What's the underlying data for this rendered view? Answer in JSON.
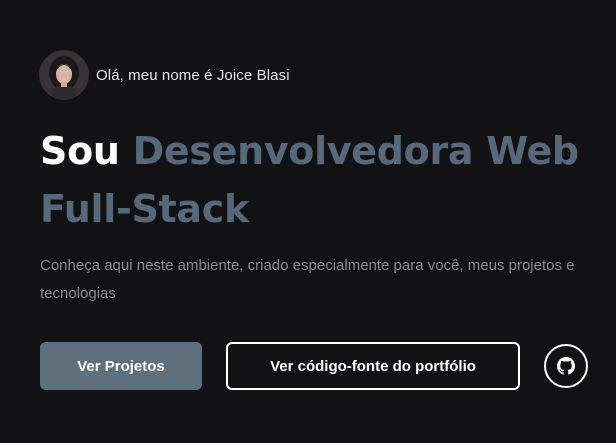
{
  "intro": {
    "greeting": "Olá, meu nome é Joice Blasi",
    "avatar_icon": "profile-photo"
  },
  "headline": {
    "prefix": "Sou",
    "accent_line1": "Desenvolvedora Web",
    "accent_line2": "Full-Stack"
  },
  "description": "Conheça aqui neste ambiente, criado especialmente para você, meus projetos e tecnologias",
  "actions": {
    "primary_label": "Ver Projetos",
    "secondary_label": "Ver código-fonte do portfólio",
    "github_icon": "github-icon"
  },
  "colors": {
    "background": "#121214",
    "accent": "#56687a",
    "primary_button": "#5e6f7e",
    "text_muted": "#8a8a92"
  }
}
